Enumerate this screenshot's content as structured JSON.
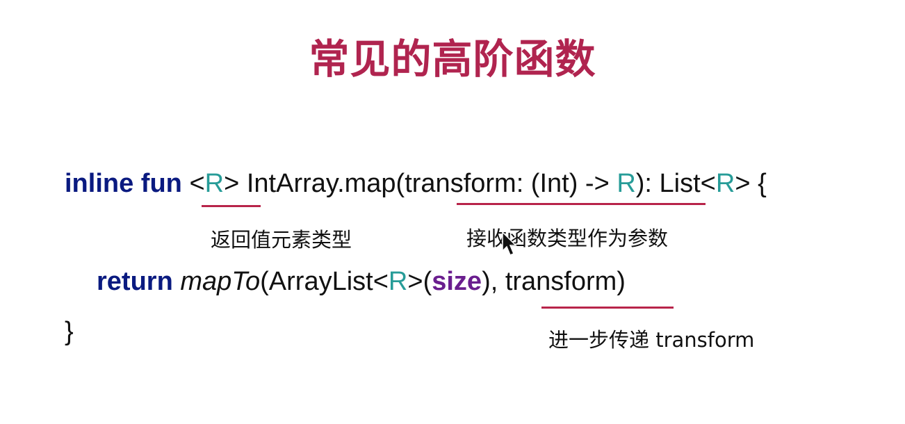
{
  "title": "常见的高阶函数",
  "code": {
    "line1": {
      "inline": "inline",
      "fun": "fun",
      "lt1": "<",
      "R1": "R",
      "gt1": ">",
      "sig": "IntArray.map(transform: (Int) -> ",
      "R2": "R",
      "sig2": "): List<",
      "R3": "R",
      "end": "> {"
    },
    "line2": {
      "return": "return",
      "mapTo": "mapTo",
      "call1": "(ArrayList<",
      "R4": "R",
      "call2": ">(",
      "size": "size",
      "call3": "), transform)"
    },
    "line3": "}"
  },
  "annotations": {
    "return_type": "返回值元素类型",
    "fn_param": "接收函数类型作为参数",
    "pass_on": "进一步传递 transform"
  },
  "colors": {
    "title": "#b0244f",
    "keyword": "#0a1a80",
    "type_param": "#279c98",
    "property": "#6a1e8e",
    "underline": "#b8244a"
  }
}
